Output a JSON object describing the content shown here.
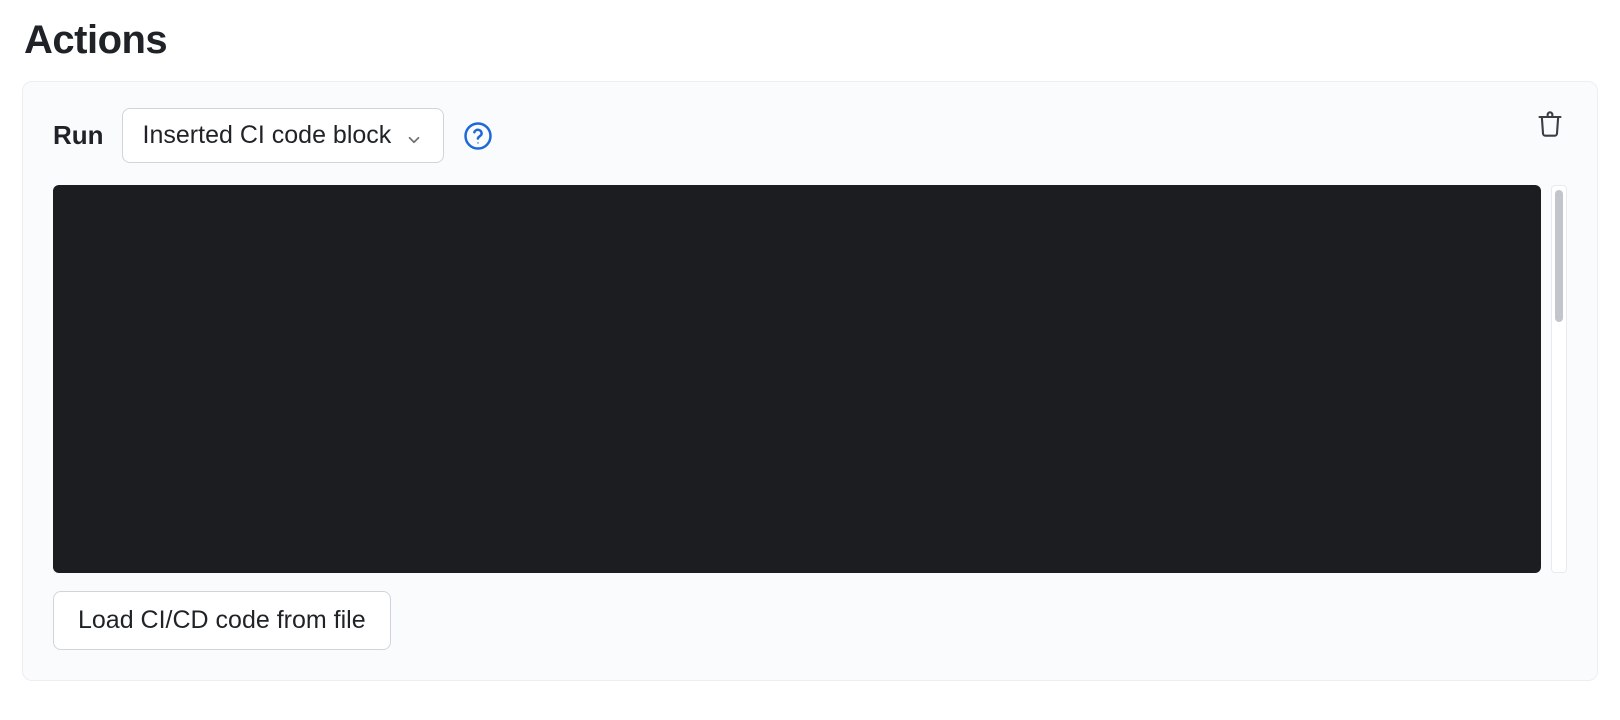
{
  "header": {
    "title": "Actions"
  },
  "action": {
    "run_label": "Run",
    "type_dropdown": {
      "selected": "Inserted CI code block"
    },
    "help_icon": "help-icon",
    "delete_icon": "trash-icon",
    "editor": {
      "content": "",
      "bg": "#1b1d21"
    },
    "load_button_label": "Load CI/CD code from file"
  },
  "colors": {
    "card_bg": "#fafbfc",
    "border": "#d0d5dc",
    "accent": "#1f69d6",
    "text": "#1f2328"
  }
}
